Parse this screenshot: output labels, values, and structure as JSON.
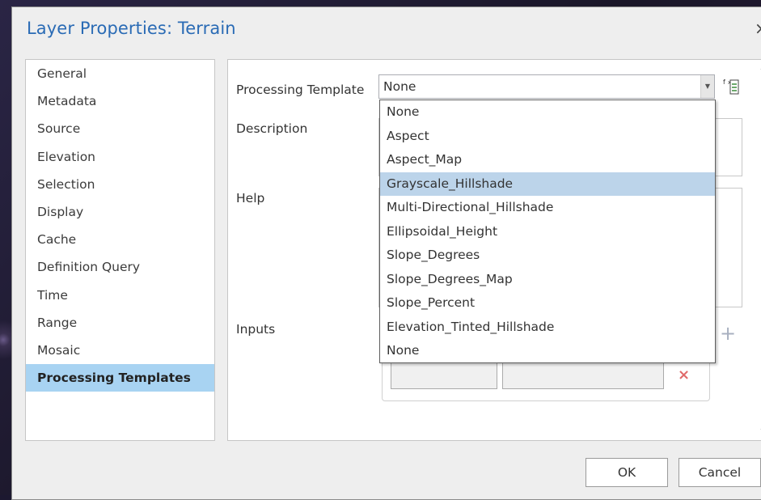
{
  "dialog": {
    "title": "Layer Properties: Terrain",
    "close_glyph": "×"
  },
  "sidebar": {
    "items": [
      {
        "label": "General",
        "selected": false
      },
      {
        "label": "Metadata",
        "selected": false
      },
      {
        "label": "Source",
        "selected": false
      },
      {
        "label": "Elevation",
        "selected": false
      },
      {
        "label": "Selection",
        "selected": false
      },
      {
        "label": "Display",
        "selected": false
      },
      {
        "label": "Cache",
        "selected": false
      },
      {
        "label": "Definition Query",
        "selected": false
      },
      {
        "label": "Time",
        "selected": false
      },
      {
        "label": "Range",
        "selected": false
      },
      {
        "label": "Mosaic",
        "selected": false
      },
      {
        "label": "Processing Templates",
        "selected": true
      }
    ]
  },
  "form": {
    "processing_template_label": "Processing Template",
    "processing_template_value": "None",
    "description_label": "Description",
    "help_label": "Help",
    "inputs_label": "Inputs"
  },
  "dropdown": {
    "options": [
      "None",
      "Aspect",
      "Aspect_Map",
      "Grayscale_Hillshade",
      "Multi-Directional_Hillshade",
      "Ellipsoidal_Height",
      "Slope_Degrees",
      "Slope_Degrees_Map",
      "Slope_Percent",
      "Elevation_Tinted_Hillshade",
      "None"
    ],
    "highlighted_index": 3
  },
  "buttons": {
    "ok": "OK",
    "cancel": "Cancel"
  },
  "colors": {
    "title": "#2a6bb5",
    "selected_nav": "#a8d3f2",
    "highlighted_option": "#bcd4ea"
  }
}
